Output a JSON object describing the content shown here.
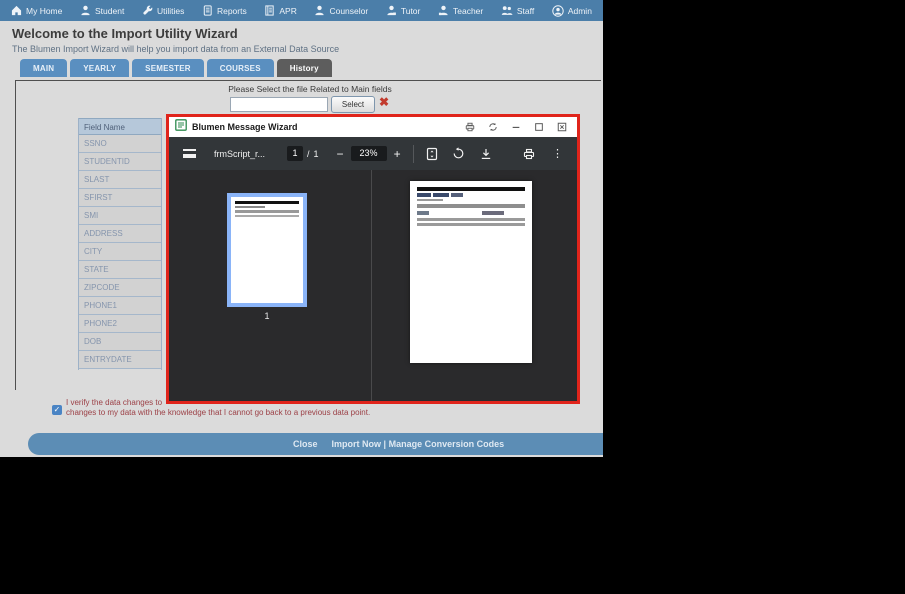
{
  "nav": {
    "items": [
      {
        "label": "My Home",
        "icon": "home-icon"
      },
      {
        "label": "Student",
        "icon": "student-icon"
      },
      {
        "label": "Utilities",
        "icon": "utilities-icon"
      },
      {
        "label": "Reports",
        "icon": "reports-icon"
      },
      {
        "label": "APR",
        "icon": "apr-icon"
      },
      {
        "label": "Counselor",
        "icon": "counselor-icon"
      },
      {
        "label": "Tutor",
        "icon": "tutor-icon"
      },
      {
        "label": "Teacher",
        "icon": "teacher-icon"
      },
      {
        "label": "Staff",
        "icon": "staff-icon"
      },
      {
        "label": "Admin",
        "icon": "admin-icon"
      }
    ]
  },
  "header": {
    "title": "Welcome to the Import Utility Wizard",
    "subtitle": "The Blumen Import Wizard will help you import data from an External Data Source"
  },
  "tabs": [
    {
      "label": "MAIN",
      "active": false
    },
    {
      "label": "YEARLY",
      "active": false
    },
    {
      "label": "SEMESTER",
      "active": false
    },
    {
      "label": "COURSES",
      "active": false
    },
    {
      "label": "History",
      "active": true
    }
  ],
  "file_select": {
    "prompt": "Please Select the file Related to Main fields",
    "input_value": "",
    "button_label": "Select",
    "clear_glyph": "✖"
  },
  "field_table": {
    "header": "Field Name",
    "rows": [
      "SSNO",
      "STUDENTID",
      "SLAST",
      "SFIRST",
      "SMI",
      "ADDRESS",
      "CITY",
      "STATE",
      "ZIPCODE",
      "PHONE1",
      "PHONE2",
      "DOB",
      "ENTRYDATE"
    ]
  },
  "verify": {
    "check_glyph": "✓",
    "line1": "I verify the data changes to",
    "line2": "changes to my data with the knowledge that I cannot go back to a previous data point."
  },
  "footer": {
    "close_label": "Close",
    "import_label": "Import Now",
    "separator": "|",
    "manage_label": "Manage Conversion Codes"
  },
  "modal": {
    "title": "Blumen Message Wizard",
    "titlebar_icons": [
      "print-icon",
      "refresh-icon",
      "minimize-icon",
      "maximize-icon",
      "close-icon"
    ],
    "pdf": {
      "filename": "frmScript_r...",
      "page_current": "1",
      "page_divider": "/",
      "page_total": "1",
      "zoom_out_glyph": "−",
      "zoom_value": "23%",
      "zoom_in_glyph": "+",
      "more_glyph": "⋮",
      "thumbnail_label": "1"
    }
  },
  "colors": {
    "navbar": "#4b7ea9",
    "tab": "#5a8fc0",
    "tab_active": "#5d5d5d",
    "modal_border": "#e0241b",
    "pdf_toolbar": "#323639",
    "viewer_bg": "#2a2a2c",
    "thumbnail_selection": "#8ab4f8",
    "footer_bar": "#5c8db5",
    "verify_text": "#9c4147",
    "clear_x": "#c23b2e"
  }
}
